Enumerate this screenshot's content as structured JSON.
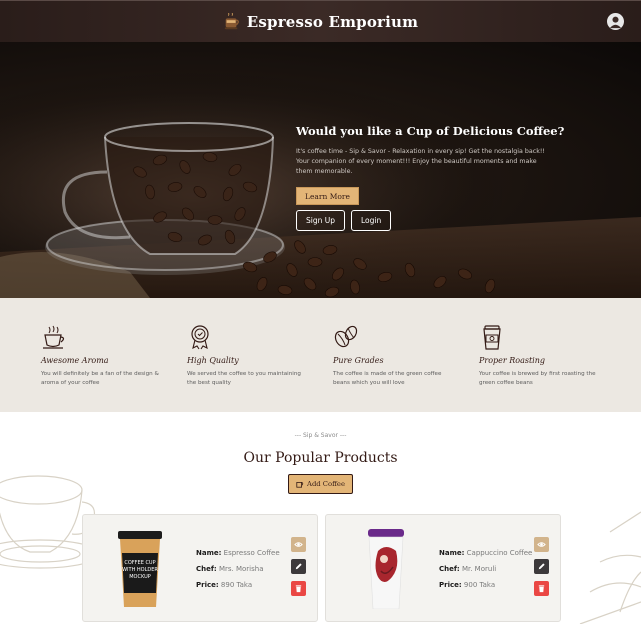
{
  "navbar": {
    "title": "Espresso Emporium"
  },
  "hero": {
    "title": "Would you like a Cup of Delicious Coffee?",
    "text": "It's coffee time - Sip & Savor - Relaxation in every sip! Get the nostalgia back!! Your companion of every moment!!! Enjoy the beautiful moments and make them memorable.",
    "learn_more": "Learn More",
    "sign_up": "Sign Up",
    "login": "Login"
  },
  "features": [
    {
      "icon": "coffee-cup-icon",
      "title": "Awesome Aroma",
      "text": "You will definitely be a fan of the design & aroma of your coffee"
    },
    {
      "icon": "quality-badge-icon",
      "title": "High Quality",
      "text": "We served the coffee to you maintaining the best quality"
    },
    {
      "icon": "coffee-beans-icon",
      "title": "Pure Grades",
      "text": "The coffee is made of the green coffee beans which you will love"
    },
    {
      "icon": "takeaway-cup-icon",
      "title": "Proper Roasting",
      "text": "Your coffee is brewed by first roasting the green coffee beans"
    }
  ],
  "products": {
    "subtitle": "--- Sip & Savor ---",
    "title": "Our Popular Products",
    "add_button": "Add Coffee",
    "labels": {
      "name": "Name:",
      "chef": "Chef:",
      "price": "Price:"
    },
    "items": [
      {
        "name": "Espresso Coffee",
        "chef": "Mrs. Morisha",
        "price": "890 Taka"
      },
      {
        "name": "Cappuccino Coffee",
        "chef": "Mr. Moruli",
        "price": "900 Taka"
      }
    ]
  },
  "colors": {
    "accent": "#e3b577",
    "brown": "#331a15",
    "delete": "#ea4744",
    "edit": "#3c393b",
    "view": "#d2b48c"
  }
}
